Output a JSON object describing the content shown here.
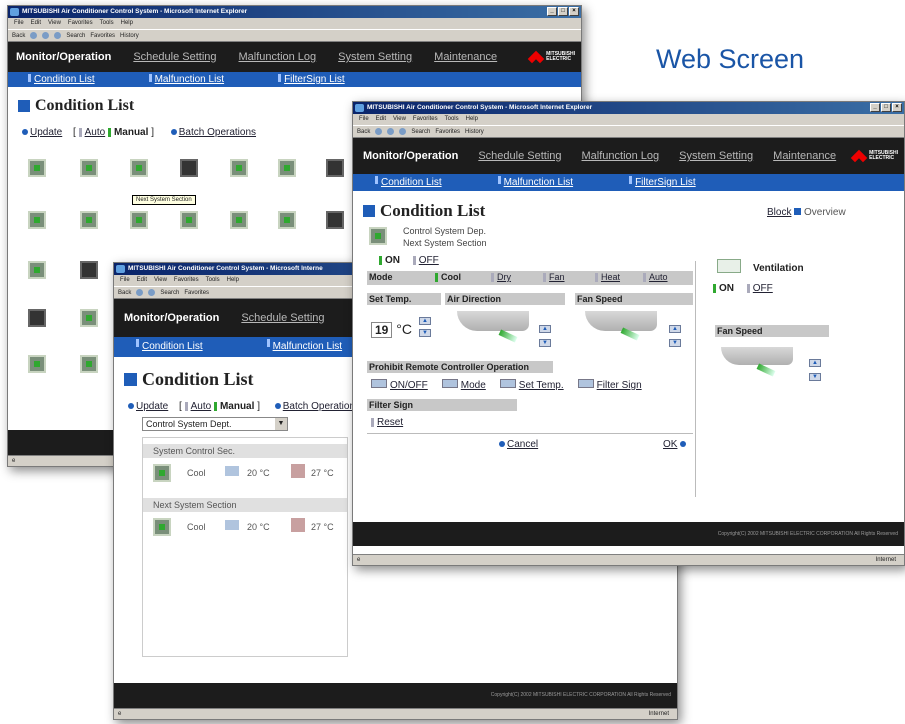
{
  "heading": "Web Screen",
  "window_title": "MITSUBISHI Air Conditioner Control System - Microsoft Internet Explorer",
  "window_title_short": "MITSUBISHI Air Conditioner Control System - Microsoft Interne",
  "menu": [
    "File",
    "Edit",
    "View",
    "Favorites",
    "Tools",
    "Help"
  ],
  "toolbar": {
    "back": "Back",
    "search": "Search",
    "favorites": "Favorites",
    "history": "History"
  },
  "nav": {
    "main": "Monitor/Operation",
    "links": [
      "Schedule Setting",
      "Malfunction Log",
      "System Setting",
      "Maintenance"
    ],
    "logo": [
      "MITSUBISHI",
      "ELECTRIC"
    ]
  },
  "subnav": [
    "Condition List",
    "Malfunction List",
    "FilterSign List"
  ],
  "page_title": "Condition List",
  "controls": {
    "update": "Update",
    "bracket_open": "[",
    "auto": "Auto",
    "manual": "Manual",
    "bracket_close": "]",
    "batch": "Batch Operations"
  },
  "tooltip": "Next System Section",
  "footer": "Copyright(C) 2002 MITSUBISHI ELECTRIC CORPORATION All Rights Reserved",
  "status_internet": "Internet",
  "window3": {
    "dropdown": "Control System Dept.",
    "sections": [
      {
        "name": "System Control Sec.",
        "mode": "Cool",
        "set": "20 °C",
        "room": "27 °C"
      },
      {
        "name": "Next System Section",
        "mode": "Cool",
        "set": "20 °C",
        "room": "27 °C"
      }
    ]
  },
  "window2": {
    "block": "Block",
    "overview": "Overview",
    "group_line1": "Control System Dep.",
    "group_line2": "Next System Section",
    "on": "ON",
    "off": "OFF",
    "mode_label": "Mode",
    "modes": [
      "Cool",
      "Dry",
      "Fan",
      "Heat",
      "Auto"
    ],
    "set_temp_label": "Set Temp.",
    "air_direction_label": "Air Direction",
    "fan_speed_label": "Fan Speed",
    "temp_value": "19",
    "temp_unit": "°C",
    "ventilation": "Ventilation",
    "vent_on": "ON",
    "vent_off": "OFF",
    "vent_fan_speed": "Fan Speed",
    "prohibit_label": "Prohibit Remote Controller Operation",
    "prohibit_items": [
      "ON/OFF",
      "Mode",
      "Set Temp.",
      "Filter Sign"
    ],
    "filter_sign_label": "Filter Sign",
    "reset": "Reset",
    "cancel": "Cancel",
    "ok": "OK"
  }
}
